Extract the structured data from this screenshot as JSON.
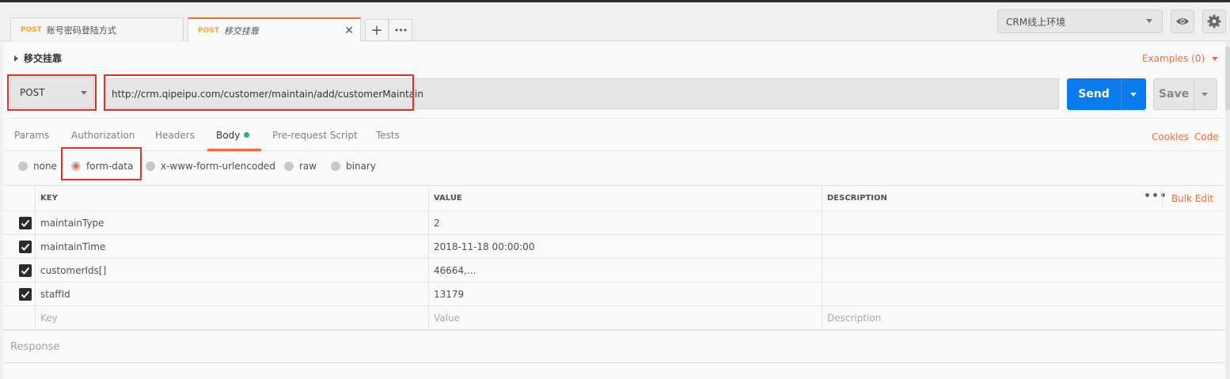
{
  "tabs": [
    {
      "method": "POST",
      "name": "账号密码登陆方式",
      "active": false
    },
    {
      "method": "POST",
      "name": "移交挂靠",
      "active": true
    }
  ],
  "tab_controls": {
    "new_tab": "+",
    "more": "•••"
  },
  "environment": {
    "selected": "CRM线上环境"
  },
  "request": {
    "title": "移交挂靠",
    "examples_label": "Examples (0)",
    "method": "POST",
    "url": "http://crm.qipeipu.com/customer/maintain/add/customerMaintain",
    "send_label": "Send",
    "save_label": "Save"
  },
  "subtabs": [
    {
      "label": "Params"
    },
    {
      "label": "Authorization"
    },
    {
      "label": "Headers"
    },
    {
      "label": "Body",
      "active": true
    },
    {
      "label": "Pre-request Script"
    },
    {
      "label": "Tests"
    }
  ],
  "links": {
    "cookies": "Cookies",
    "code": "Code"
  },
  "body_modes": [
    {
      "label": "none"
    },
    {
      "label": "form-data",
      "selected": true
    },
    {
      "label": "x-www-form-urlencoded"
    },
    {
      "label": "raw"
    },
    {
      "label": "binary"
    }
  ],
  "table": {
    "headers": {
      "key": "KEY",
      "value": "VALUE",
      "description": "DESCRIPTION"
    },
    "bulk_edit": "Bulk Edit",
    "rows": [
      {
        "key": "maintainType",
        "value": "2",
        "description": "",
        "checked": true
      },
      {
        "key": "maintainTime",
        "value": "2018-11-18 00:00:00",
        "description": "",
        "checked": true
      },
      {
        "key": "customerIds[]",
        "value": "46664,...",
        "description": "",
        "checked": true
      },
      {
        "key": "staffId",
        "value": "13179",
        "description": "",
        "checked": true
      }
    ],
    "placeholders": {
      "key": "Key",
      "value": "Value",
      "description": "Description"
    }
  },
  "response_label": "Response",
  "colors": {
    "accent": "#f26b3a",
    "send_blue": "#097bed",
    "highlight_red": "#e0322a",
    "status_green": "#26b47f"
  }
}
